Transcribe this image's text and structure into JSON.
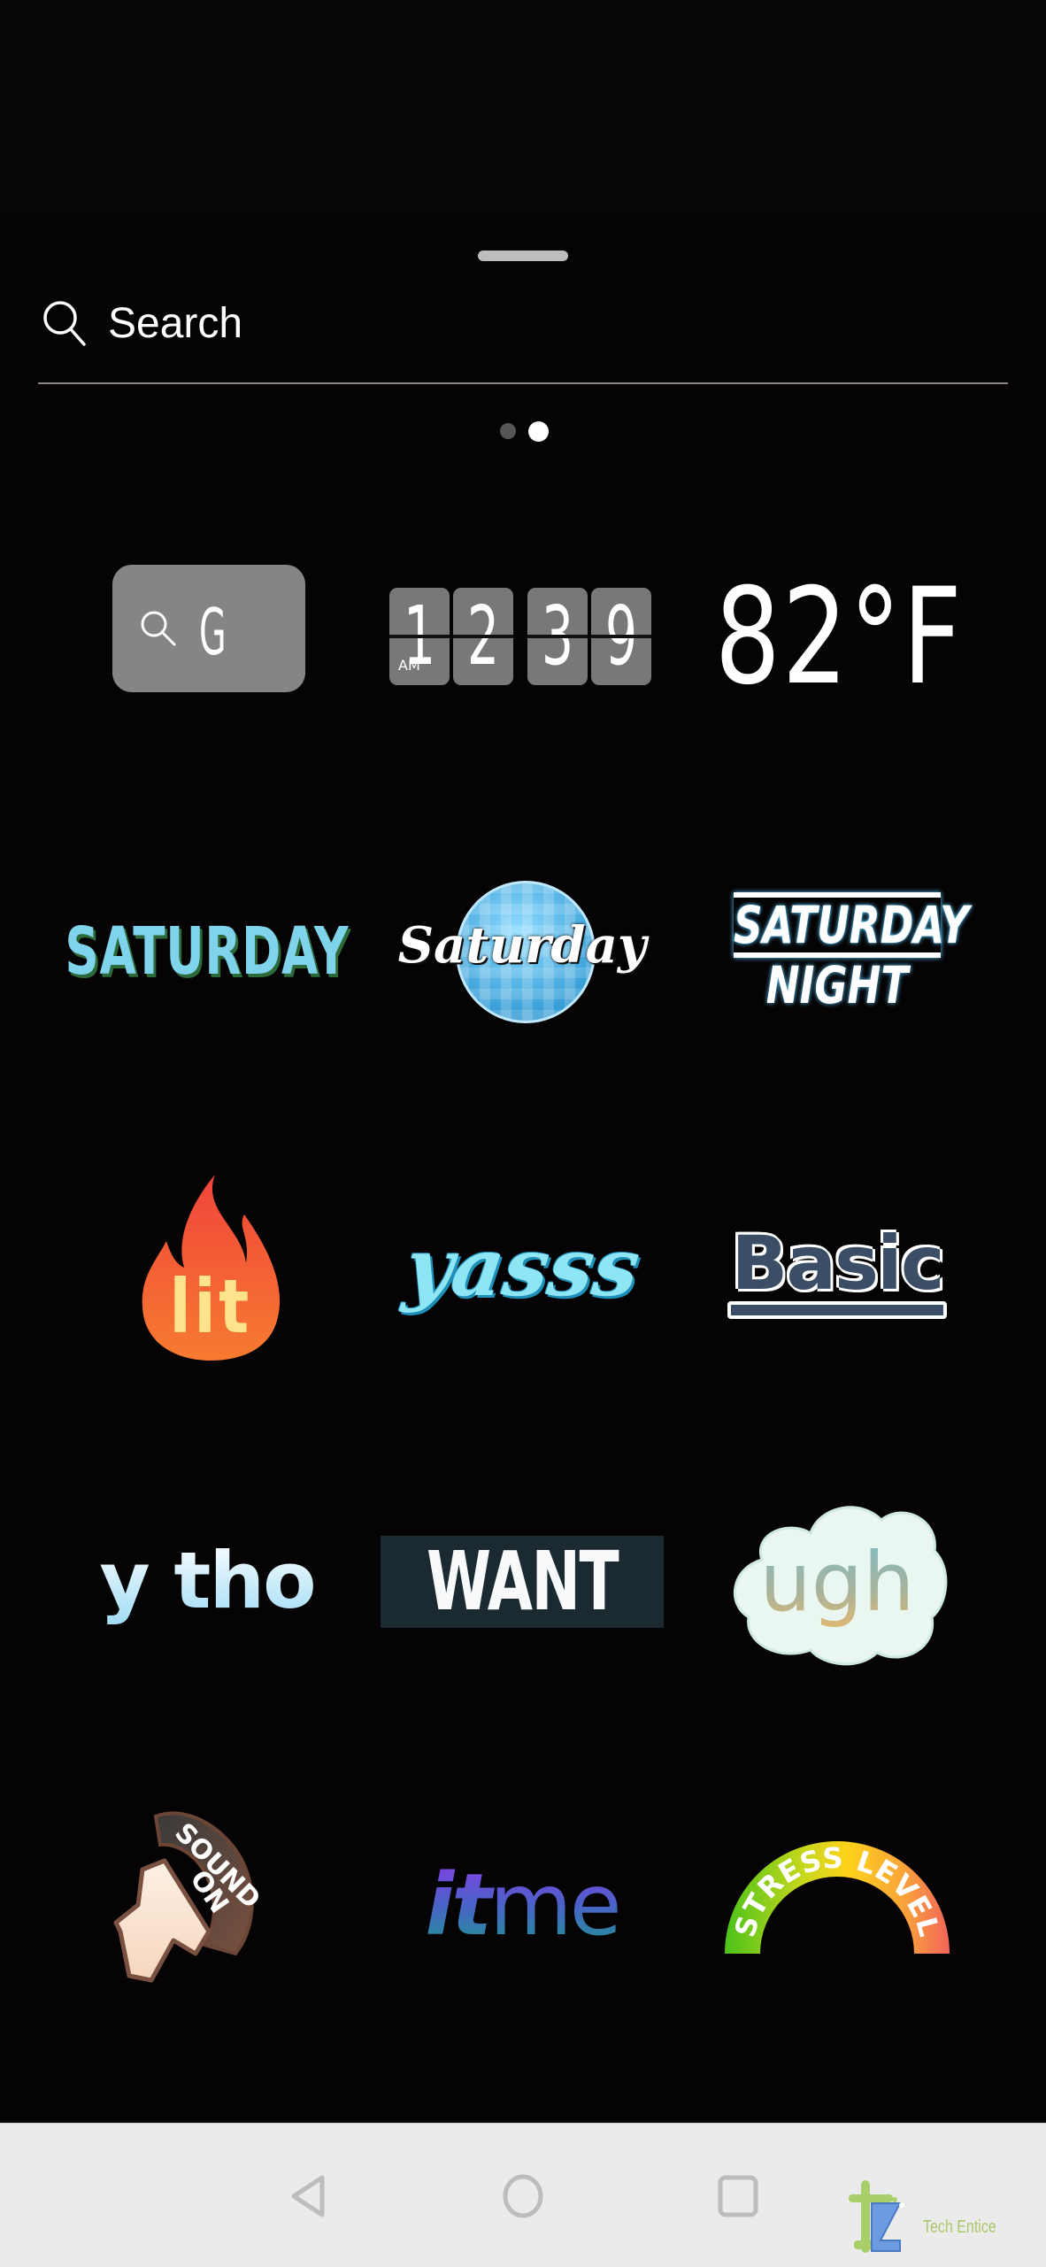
{
  "sheet": {
    "drag_handle": "drag-handle",
    "search": {
      "placeholder": "Search",
      "icon": "search-icon"
    },
    "pager": {
      "pages": 2,
      "current_page": 2
    }
  },
  "stickers": [
    {
      "id": "search",
      "label": "G",
      "icon": "search-icon"
    },
    {
      "id": "time",
      "hour_digits": [
        "1",
        "2"
      ],
      "minute_digits": [
        "3",
        "9"
      ],
      "meridiem": "AM"
    },
    {
      "id": "temperature",
      "label": "82°F"
    },
    {
      "id": "saturday-outline",
      "label": "SATURDAY"
    },
    {
      "id": "saturday-disco",
      "label": "Saturday"
    },
    {
      "id": "saturday-night",
      "line1": "SATURDAY",
      "line2": "NIGHT"
    },
    {
      "id": "lit",
      "label": "lit"
    },
    {
      "id": "yasss",
      "label": "yasss"
    },
    {
      "id": "basic",
      "label": "Basic"
    },
    {
      "id": "y-tho",
      "label": "y tho"
    },
    {
      "id": "want",
      "label": "WANT"
    },
    {
      "id": "ugh",
      "label": "ugh"
    },
    {
      "id": "sound-on",
      "line1": "SOUND",
      "line2": "ON"
    },
    {
      "id": "it-me",
      "part1": "it",
      "part2": "me"
    },
    {
      "id": "stress-level",
      "label": "STRESS LEVEL"
    }
  ],
  "navbar": {
    "back": "back-icon",
    "home": "home-icon",
    "recents": "recents-icon"
  },
  "watermark": {
    "text": "Tech Entice"
  },
  "colors": {
    "background": "#050304",
    "navbar_bg": "#ebebeb",
    "nav_icon": "#bdbdbd",
    "search_sticker_bg": "#858585",
    "clock_tile": "#787878",
    "saturday_fill": "#7fd3ea",
    "saturday_shadow": "#2d6a3a",
    "basic_text": "#3c4e66"
  }
}
